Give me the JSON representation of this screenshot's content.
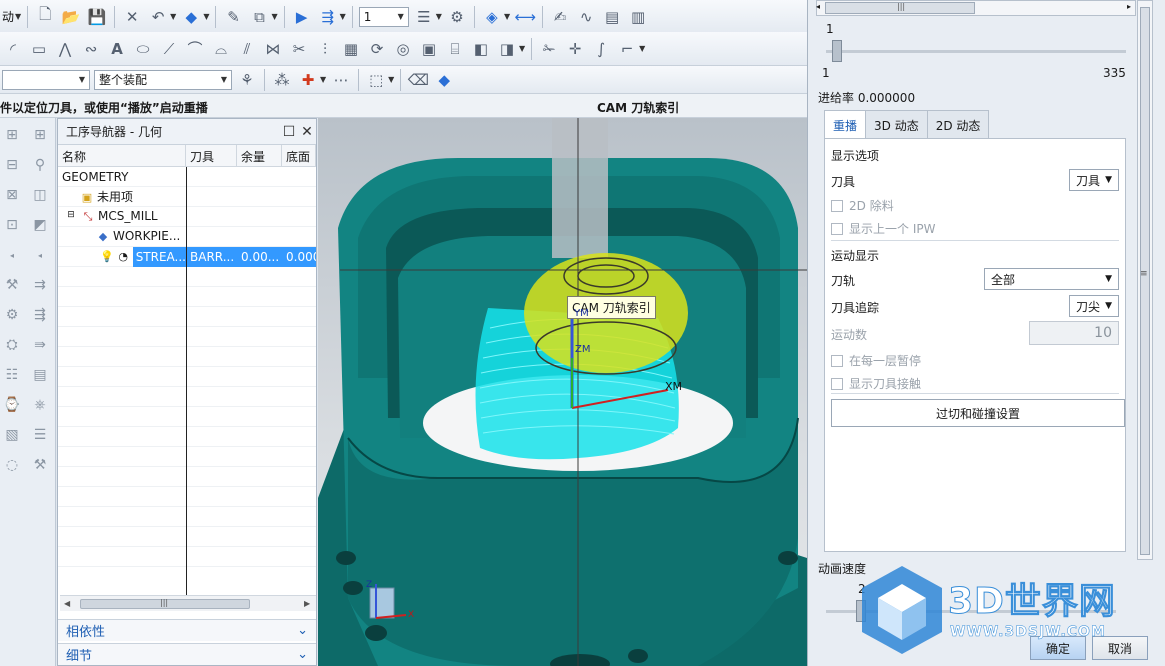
{
  "toolbar": {
    "edge_label": "动",
    "layer_value": "1",
    "filter_combo": "",
    "assembly_combo": "整个装配"
  },
  "status": {
    "prompt": "件以定位刀具，或使用“播放”启动重播",
    "title": "CAM 刀轨索引"
  },
  "navigator": {
    "title": "工序导航器 - 几何",
    "columns": [
      "名称",
      "刀具",
      "余量",
      "底面"
    ],
    "rows": [
      {
        "name": "GEOMETRY",
        "tool": "",
        "stock": "",
        "floor": ""
      },
      {
        "name": "未用项",
        "tool": "",
        "stock": "",
        "floor": ""
      },
      {
        "name": "MCS_MILL",
        "tool": "",
        "stock": "",
        "floor": ""
      },
      {
        "name": "WORKPIE...",
        "tool": "",
        "stock": "",
        "floor": ""
      },
      {
        "name": "STREA...",
        "tool": "BARR...",
        "stock": "0.00...",
        "floor": "0.000"
      }
    ],
    "accordion": [
      "相依性",
      "细节"
    ]
  },
  "viewport": {
    "tooltip": "CAM 刀轨索引",
    "axis_ym": "YM",
    "axis_xm": "XM",
    "axis_zm": "ZM",
    "triad_z": "Z",
    "triad_x": "X"
  },
  "panel": {
    "slider_value": "1",
    "slider_min": "1",
    "slider_max": "335",
    "feed_rate": "进给率 0.000000",
    "tabs": [
      "重播",
      "3D 动态",
      "2D 动态"
    ],
    "display_options_title": "显示选项",
    "tool_label": "刀具",
    "tool_value": "刀具",
    "cb_2d_remove": "2D 除料",
    "cb_show_prev_ipw": "显示上一个 IPW",
    "motion_display_title": "运动显示",
    "toolpath_label": "刀轨",
    "toolpath_value": "全部",
    "tool_trace_label": "刀具追踪",
    "tool_trace_value": "刀尖",
    "motion_count_label": "运动数",
    "motion_count_value": "10",
    "cb_pause_each_layer": "在每一层暂停",
    "cb_show_tool_contact": "显示刀具接触",
    "gouge_button": "过切和碰撞设置",
    "anim_speed_label": "动画速度",
    "anim_speed_value": "2",
    "ok_button": "确定",
    "cancel_button": "取消"
  },
  "watermark": {
    "brand": "3D世界网",
    "url": "WWW.3DSJW.COM"
  },
  "colors": {
    "selection": "#3399ff",
    "part_teal": "#0f7a78",
    "toolpath_cyan": "#13e0e8",
    "tool_yellow": "#d9e21a",
    "accent_blue": "#1f5fb3"
  }
}
